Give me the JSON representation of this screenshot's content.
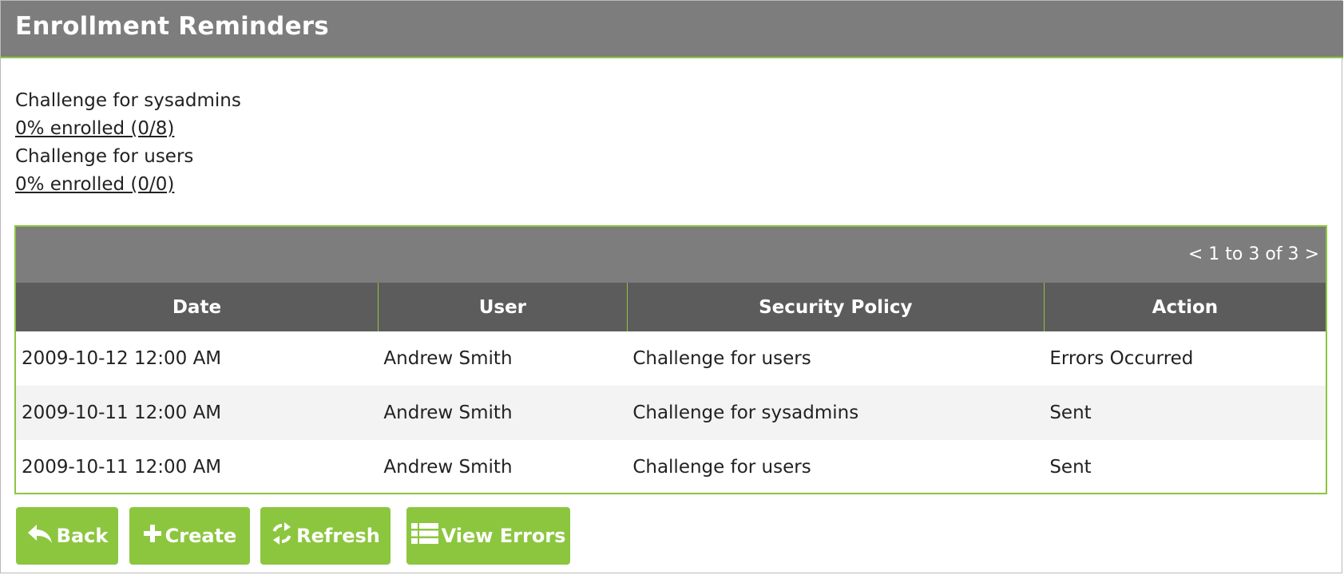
{
  "panel": {
    "title": "Enrollment Reminders"
  },
  "policies": [
    {
      "name": "Challenge for sysadmins",
      "enrollment": "0% enrolled (0/8)"
    },
    {
      "name": "Challenge for users",
      "enrollment": "0% enrolled (0/0)"
    }
  ],
  "grid": {
    "pager": {
      "prev": "<",
      "range": "1 to 3 of 3",
      "next": ">"
    },
    "columns": [
      "Date",
      "User",
      "Security Policy",
      "Action"
    ],
    "rows": [
      {
        "date": "2009-10-12 12:00 AM",
        "user": "Andrew Smith",
        "policy": "Challenge for users",
        "action": "Errors Occurred"
      },
      {
        "date": "2009-10-11 12:00 AM",
        "user": "Andrew Smith",
        "policy": "Challenge for sysadmins",
        "action": "Sent"
      },
      {
        "date": "2009-10-11 12:00 AM",
        "user": "Andrew Smith",
        "policy": "Challenge for users",
        "action": "Sent"
      }
    ]
  },
  "toolbar": {
    "back": {
      "label": "Back",
      "icon": "reply-arrow-icon"
    },
    "create": {
      "label": "Create",
      "icon": "plus-icon"
    },
    "refresh": {
      "label": "Refresh",
      "icon": "refresh-icon"
    },
    "view_errors": {
      "label": "View Errors",
      "icon": "list-icon"
    }
  },
  "colors": {
    "header_bg": "#7d7d7d",
    "column_header_bg": "#5c5c5c",
    "accent_green": "#8cc63f",
    "alt_row_bg": "#f3f3f3"
  }
}
